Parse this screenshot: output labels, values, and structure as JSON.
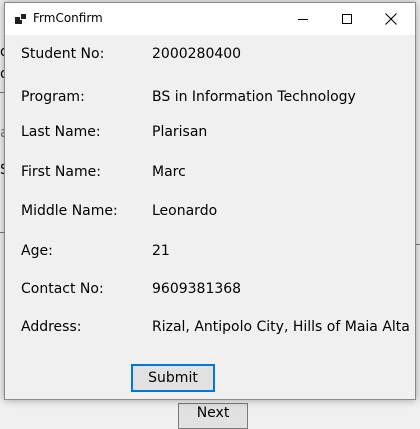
{
  "window": {
    "title": "FrmConfirm",
    "submit_label": "Submit"
  },
  "fields": [
    {
      "label": "Student No:",
      "value": "2000280400"
    },
    {
      "label": "Program:",
      "value": "BS in Information Technology"
    },
    {
      "label": "Last Name:",
      "value": "Plarisan"
    },
    {
      "label": "First Name:",
      "value": "Marc"
    },
    {
      "label": "Middle Name:",
      "value": "Leonardo"
    },
    {
      "label": "Age:",
      "value": "21"
    },
    {
      "label": "Contact No:",
      "value": "9609381368"
    },
    {
      "label": "Address:",
      "value": "Rizal, Antipolo City, Hills of Maia Alta"
    }
  ],
  "background": {
    "fragments": [
      "d",
      "o",
      "a",
      "S"
    ],
    "next_label": "Next"
  }
}
